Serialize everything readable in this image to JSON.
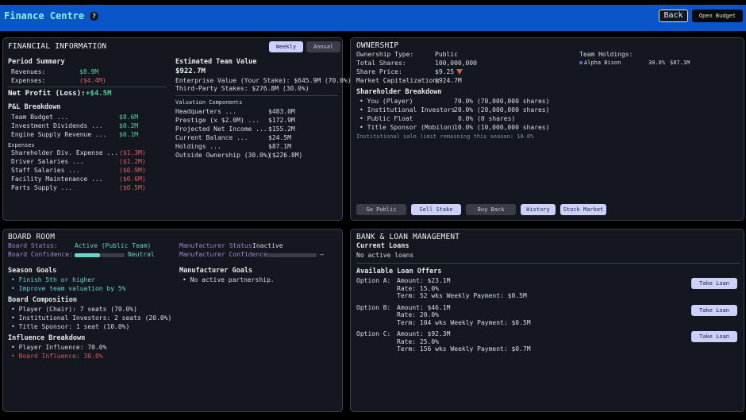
{
  "header": {
    "title": "Finance Centre",
    "help": "?",
    "back": "Back",
    "open_budget": "Open Budget"
  },
  "financial": {
    "title": "FINANCIAL INFORMATION",
    "toggle_weekly": "Weekly",
    "toggle_annual": "Annual",
    "period_summary": "Period Summary",
    "revenues_label": "Revenues:",
    "revenues": "$8.9M",
    "expenses_label": "Expenses:",
    "expenses": "($4.4M)",
    "net_profit_label": "Net Profit (Loss):",
    "net_profit": "+$4.5M",
    "pl_title": "P&L Breakdown",
    "income": [
      {
        "label": "Team Budget ...",
        "value": "$8.6M"
      },
      {
        "label": "Investment Dividends ...",
        "value": "$0.2M"
      },
      {
        "label": "Engine Supply Revenue ...",
        "value": "$0.1M"
      }
    ],
    "expenses_title": "Expenses",
    "expense_items": [
      {
        "label": "Shareholder Div. Expense ...",
        "value": "($1.3M)"
      },
      {
        "label": "Driver Salaries ...",
        "value": "($1.2M)"
      },
      {
        "label": "Staff Salaries ...",
        "value": "($0.9M)"
      },
      {
        "label": "Facility Maintenance ...",
        "value": "($0.6M)"
      },
      {
        "label": "Parts Supply ...",
        "value": "($0.5M)"
      }
    ],
    "etv_title": "Estimated Team Value",
    "etv": "$922.7M",
    "enterprise": "Enterprise Value (Your Stake): $645.9M (70.0%)",
    "third_party": "Third-Party Stakes: $276.8M (30.0%)",
    "valuation_title": "Valuation Components",
    "valuation": [
      {
        "label": "Headquarters ...",
        "value": "$483.0M"
      },
      {
        "label": "Prestige (x $2.0M) ...",
        "value": "$172.9M"
      },
      {
        "label": "Projected Net Income ...",
        "value": "$155.2M"
      },
      {
        "label": "Current Balance ...",
        "value": "$24.5M"
      },
      {
        "label": "Holdings ...",
        "value": "$87.1M"
      },
      {
        "label": "Outside Ownership (30.0%) ...",
        "value": "($276.8M)"
      }
    ]
  },
  "ownership": {
    "title": "OWNERSHIP",
    "type_label": "Ownership Type:",
    "type": "Public",
    "shares_label": "Total Shares:",
    "shares": "100,000,000",
    "price_label": "Share Price:",
    "price": "$9.25",
    "cap_label": "Market Capitalization:",
    "cap": "$924.7M",
    "holdings_title": "Team Holdings:",
    "holding": {
      "name": "Alpha Bison",
      "pct": "30.0%",
      "value": "$87.1M"
    },
    "sh_title": "Shareholder Breakdown",
    "shareholders": [
      {
        "label": "• You (Player)",
        "value": "70.0% (70,000,000 shares)"
      },
      {
        "label": "• Institutional Investors",
        "value": "20.0% (20,000,000 shares)"
      },
      {
        "label": "• Public Float",
        "value": "0.0% (0 shares)"
      },
      {
        "label": "• Title Sponsor (Mobilon)",
        "value": "10.0% (10,000,000 shares)"
      }
    ],
    "note": "Institutional sale limit remaining this season: 10.0%",
    "buttons": [
      "Go Public",
      "Sell Stake",
      "Buy Back",
      "History",
      "Stock Market"
    ]
  },
  "board": {
    "title": "BOARD ROOM",
    "status_label": "Board Status:",
    "status": "Active (Public Team)",
    "confidence_label": "Board Confidence:",
    "confidence_text": "Neutral",
    "confidence_level": 0.5,
    "mfr_status_label": "Manufacturer Status:",
    "mfr_status": "Inactive",
    "mfr_conf_label": "Manufacturer Confidence:",
    "mfr_conf_text": "—",
    "mfr_conf_level": 0,
    "season_goals_title": "Season Goals",
    "season_goals": [
      "• Finish 5th or higher",
      "• Improve team valuation by 5%"
    ],
    "mfr_goals_title": "Manufacturer Goals",
    "mfr_goals": [
      "• No active partnership."
    ],
    "composition_title": "Board Composition",
    "composition": [
      "• Player (Chair): 7 seats (70.0%)",
      "• Institutional Investors: 2 seats (20.0%)",
      "• Title Sponsor: 1 seat (10.0%)"
    ],
    "influence_title": "Influence Breakdown",
    "player_influence": "• Player Influence: 70.0%",
    "board_influence": "• Board Influence: 30.0%"
  },
  "bank": {
    "title": "BANK & LOAN MANAGEMENT",
    "current_title": "Current Loans",
    "current_none": "No active loans",
    "offers_title": "Available Loan Offers",
    "offers": [
      {
        "name": "Option A:",
        "amount": "Amount: $23.1M",
        "rate": "Rate: 15.0%",
        "term": "Term: 52 wks  Weekly Payment: $0.5M",
        "button": "Take Loan"
      },
      {
        "name": "Option B:",
        "amount": "Amount: $46.1M",
        "rate": "Rate: 20.0%",
        "term": "Term: 104 wks  Weekly Payment: $0.5M",
        "button": "Take Loan"
      },
      {
        "name": "Option C:",
        "amount": "Amount: $92.3M",
        "rate": "Rate: 25.0%",
        "term": "Term: 156 wks  Weekly Payment: $0.7M",
        "button": "Take Loan"
      }
    ]
  }
}
